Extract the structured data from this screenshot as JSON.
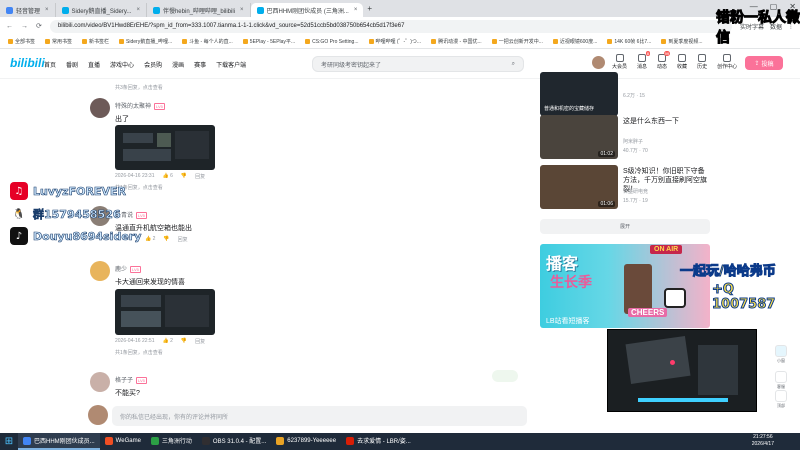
{
  "browser": {
    "tabs": [
      {
        "label": "轻音管理"
      },
      {
        "label": "Sidery鹅直播_Sidery..."
      },
      {
        "label": "伴慢hebin_哔哩哔哩_bilibili"
      },
      {
        "label": "巴西HHM刚团伙成员 (三角洲...",
        "active": true
      }
    ],
    "url": "bilibili.com/video/BV1Hwd8ErEHE/?spm_id_from=333.1007.tianma.1-1-1.click&vd_source=52d51ccb5bd038750b654cb5d17f3e67",
    "right_items": [
      "实时字幕",
      "数据"
    ],
    "bookmarks": [
      "全部书签",
      "常用书签",
      "新书签栏",
      "Sidery鹅直播_哔哩...",
      "斗鱼 - 每个人的直...",
      "5EPlay - 5EPlay平...",
      "CS:GO Pro Setting...",
      "哔哩哔哩 (゜-゜)つ...",
      "腾讯动漫 - 中国优...",
      "一把云创新开发中...",
      "近视眼镜600度...",
      "14K 60帧 6比7...",
      "到夏季度视频..."
    ]
  },
  "header": {
    "logo": "bilibili",
    "nav": [
      "首页",
      "番剧",
      "直播",
      "游戏中心",
      "会员购",
      "漫画",
      "赛事",
      "下载客户端"
    ],
    "search_placeholder": "考研同级考密钥起来了",
    "right_nav": [
      {
        "label": "大会员"
      },
      {
        "label": "消息",
        "badge": "8"
      },
      {
        "label": "动态",
        "badge": "99"
      },
      {
        "label": "收藏"
      },
      {
        "label": "历史"
      },
      {
        "label": "创作中心"
      }
    ],
    "upload_label": "投稿"
  },
  "comments": [
    {
      "user": "特殊的太聚神",
      "level": "LV5",
      "text": "出了",
      "time": "2026-04-16 23:31",
      "likes": "6",
      "reply": "回复",
      "sub": "共1条回复，点击查看"
    },
    {
      "user": "长青说",
      "level": "LV5",
      "text": "温通直升机航空箱也能出",
      "likes": "2",
      "reply": "回复"
    },
    {
      "user": "鹿少",
      "level": "LV5",
      "text": "卡大通回来发现的情喜",
      "time": "2026-04-16 22:51",
      "likes": "2",
      "reply": "回复",
      "sub": "共1条回复，点击查看"
    },
    {
      "user": "格子子",
      "level": "LV5",
      "text": "不能买?"
    }
  ],
  "sub_reply_partial": "共3条回复，点击查看",
  "reply_placeholder": "你的私信已经出现，你有的评论并将同所",
  "recommend": [
    {
      "title": "",
      "duration": "",
      "up": "",
      "views": "6.2万",
      "danmaku": "15",
      "thumb_caption": "普通和机密的宝藏储存"
    },
    {
      "title": "这是什么东西一下",
      "duration": "01:02",
      "up": "阿米胖子",
      "views": "40.7万",
      "danmaku": "70"
    },
    {
      "title": "S级冷知识！你旧职下守备方法，千万别直接刷阿空旗裂！",
      "duration": "01:06",
      "up": "日墨研电竞",
      "views": "15.7万",
      "danmaku": "19"
    }
  ],
  "expand_label": "展开",
  "ad": {
    "title": "播客",
    "subtitle": "生长季",
    "onair": "ON AIR",
    "cheers": "CHEERS",
    "tag": "LB站看短播客"
  },
  "overlay": {
    "watermark": "错粉一私人微信",
    "socials": [
      {
        "icon": "netease-icon",
        "text": "LuvyzFOREVER",
        "color": "#e60026"
      },
      {
        "icon": "qq-icon",
        "text": "群1579458526",
        "color": "#222222"
      },
      {
        "icon": "douyin-icon",
        "text": "Douyu8694sidery",
        "color": "#111111"
      }
    ],
    "promo_line1": "一起玩/哈哈弗币",
    "promo_line2": "+Q  1007587"
  },
  "sidebar": [
    {
      "label": "小窗"
    },
    {
      "label": "客服"
    },
    {
      "label": "顶部"
    }
  ],
  "taskbar": {
    "items": [
      {
        "label": "巴西HHM刚团伙成员...",
        "active": true,
        "color": "#4285f4"
      },
      {
        "label": "WeGame",
        "color": "#f04e23"
      },
      {
        "label": "三角洲行动",
        "color": "#2c9f45"
      },
      {
        "label": "OBS 31.0.4 - 配置...",
        "color": "#302e31"
      },
      {
        "label": "6237899-Yeeeeee",
        "color": "#e9a325"
      },
      {
        "label": "去求爱情 - LBR/姿...",
        "color": "#d81e06"
      }
    ],
    "time": "21:27:56",
    "date": "2026/4/17"
  }
}
